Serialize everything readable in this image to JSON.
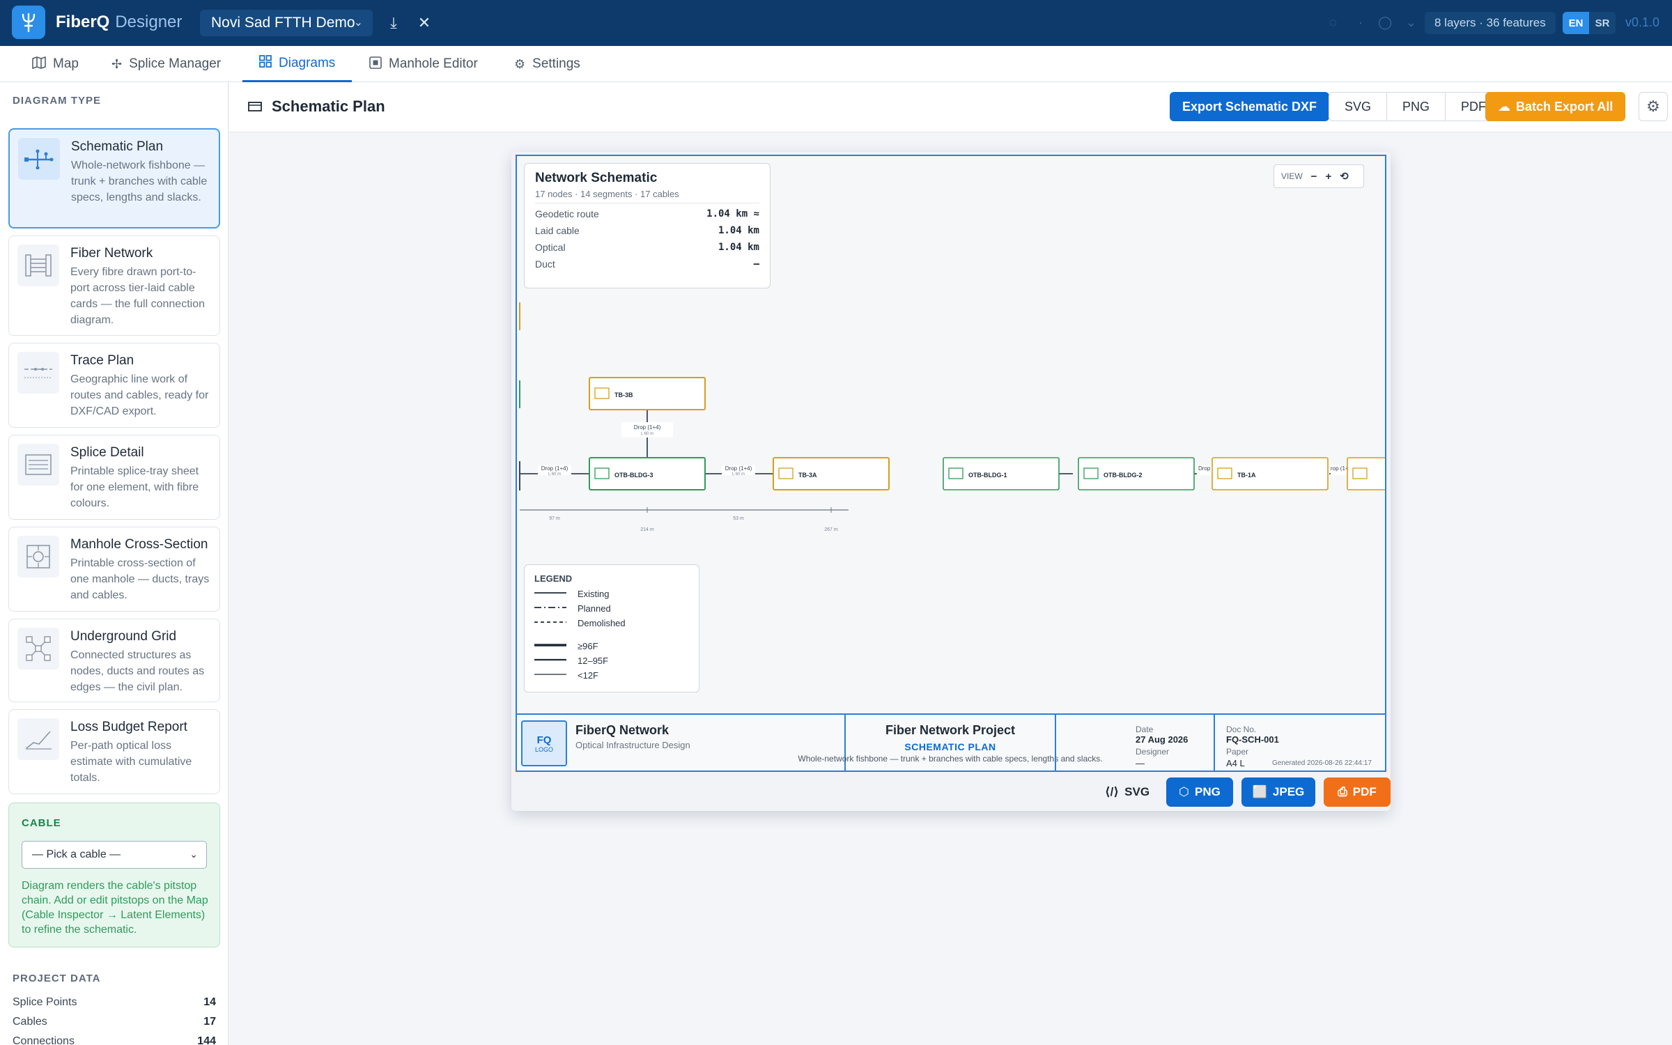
{
  "app": {
    "brand": "FiberQ",
    "brand_suffix": "Designer",
    "project": "Novi Sad FTTH Demo",
    "layers_status": "8 layers · 36 features",
    "lang_en": "EN",
    "lang_sr": "SR",
    "version": "v0.1.0"
  },
  "tabs": [
    {
      "label": "Map",
      "icon": "map-icon"
    },
    {
      "label": "Splice Manager",
      "icon": "splice-icon"
    },
    {
      "label": "Diagrams",
      "icon": "grid-icon"
    },
    {
      "label": "Manhole Editor",
      "icon": "manhole-icon"
    },
    {
      "label": "Settings",
      "icon": "gear-icon"
    }
  ],
  "sidebar": {
    "section_title": "DIAGRAM TYPE",
    "diagrams": [
      {
        "name": "Schematic Plan",
        "desc": "Whole-network fishbone — trunk + branches with cable specs, lengths and slacks."
      },
      {
        "name": "Fiber Network",
        "desc": "Every fibre drawn port-to-port across tier-laid cable cards — the full connection diagram."
      },
      {
        "name": "Trace Plan",
        "desc": "Geographic line work of routes and cables, ready for DXF/CAD export."
      },
      {
        "name": "Splice Detail",
        "desc": "Printable splice-tray sheet for one element, with fibre colours."
      },
      {
        "name": "Manhole Cross-Section",
        "desc": "Printable cross-section of one manhole — ducts, trays and cables."
      },
      {
        "name": "Underground Grid",
        "desc": "Connected structures as nodes, ducts and routes as edges — the civil plan."
      },
      {
        "name": "Loss Budget Report",
        "desc": "Per-path optical loss estimate with cumulative totals."
      }
    ],
    "cable": {
      "title": "CABLE",
      "select_value": "— Pick a cable —",
      "hint": "Diagram renders the cable's pitstop chain. Add or edit pitstops on the Map (Cable Inspector → Latent Elements) to refine the schematic."
    },
    "project_data": {
      "title": "PROJECT DATA",
      "rows": [
        {
          "label": "Splice Points",
          "value": "14"
        },
        {
          "label": "Cables",
          "value": "17"
        },
        {
          "label": "Connections",
          "value": "144"
        }
      ]
    }
  },
  "header": {
    "title": "Schematic Plan",
    "export_dxf": "Export Schematic DXF",
    "formats": [
      "SVG",
      "PNG",
      "PDF"
    ],
    "batch_export": "Batch Export All"
  },
  "schematic": {
    "card": {
      "title": "Network Schematic",
      "subtitle": "17 nodes · 14 segments · 17 cables",
      "rows": [
        {
          "label": "Geodetic route",
          "value": "1.04 km ≈"
        },
        {
          "label": "Laid cable",
          "value": "1.04 km"
        },
        {
          "label": "Optical",
          "value": "1.04 km"
        },
        {
          "label": "Duct",
          "value": "—"
        }
      ]
    },
    "view": {
      "label": "VIEW",
      "zoom_out": "−",
      "zoom_in": "+",
      "reset": "⟲"
    },
    "nodes": [
      {
        "id": "TB-3B"
      },
      {
        "id": "OTB-BLDG-3"
      },
      {
        "id": "TB-3A"
      },
      {
        "id": "OTB-BLDG-1"
      },
      {
        "id": "OTB-BLDG-2"
      },
      {
        "id": "TB-1A"
      }
    ],
    "edge_labels": {
      "drop": "Drop (1+4)",
      "drop_short": "Drop (1+",
      "drop_tail": "rop (1+",
      "len": "L 60 m"
    },
    "ruler": [
      "97 m",
      "214 m",
      "53 m",
      "267 m"
    ],
    "legend": {
      "title": "LEGEND",
      "styles": [
        "Existing",
        "Planned",
        "Demolished"
      ],
      "sizes": [
        "≥96F",
        "12–95F",
        "<12F"
      ]
    },
    "title_block": {
      "logo": "FQ",
      "logo_sub": "LOGO",
      "org": "FiberQ Network",
      "org_sub": "Optical Infrastructure Design",
      "project": "Fiber Network Project",
      "kind": "SCHEMATIC PLAN",
      "desc": "Whole-network fishbone — trunk + branches with cable specs, lengths and slacks.",
      "date_label": "Date",
      "date": "27 Aug 2026",
      "designer_label": "Designer",
      "designer": "—",
      "doc_label": "Doc No.",
      "doc": "FQ-SCH-001",
      "paper_label": "Paper",
      "paper": "A4 L",
      "generated": "Generated 2026-08-26 22:44:17"
    },
    "export": {
      "svg": "SVG",
      "png": "PNG",
      "jpeg": "JPEG",
      "pdf": "PDF"
    }
  },
  "colors": {
    "topbar": "#0d3a6b",
    "accent": "#0d6ad1",
    "orange": "#f29a12",
    "node_green": "#2e9b58",
    "node_amber": "#d69e1c"
  }
}
